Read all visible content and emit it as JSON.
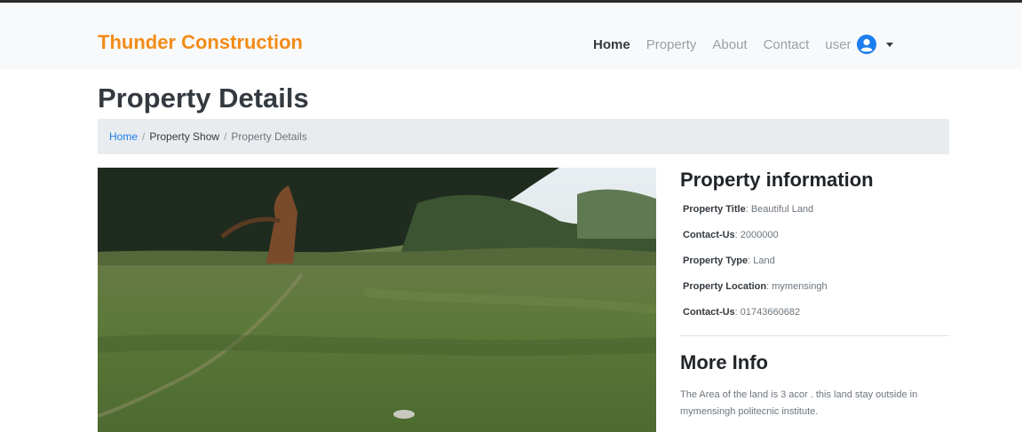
{
  "navbar": {
    "brand": "Thunder Construction",
    "links": [
      "Home",
      "Property",
      "About",
      "Contact"
    ],
    "active": "Home",
    "user": "user",
    "user_icon": "user-circle-icon",
    "brand_color": "#f28c18"
  },
  "page": {
    "title": "Property Details"
  },
  "breadcrumb": [
    "Home",
    "Property Show",
    "Property Details"
  ],
  "photo": {
    "subject": "grass-field-trees-photo"
  },
  "info": {
    "heading": "Property information",
    "rows": [
      {
        "label": "Property Title",
        "value": " Beautiful Land"
      },
      {
        "label": "Contact-Us",
        "value": " 2000000"
      },
      {
        "label": "Property Type",
        "value": " Land"
      },
      {
        "label": "Property Location",
        "value": " mymensingh"
      },
      {
        "label": "Contact-Us",
        "value": " 01743660682"
      }
    ]
  },
  "more": {
    "heading": "More Info",
    "text": "The Area of the land is 3 acor . this land stay outside in mymensingh politecnic institute."
  }
}
